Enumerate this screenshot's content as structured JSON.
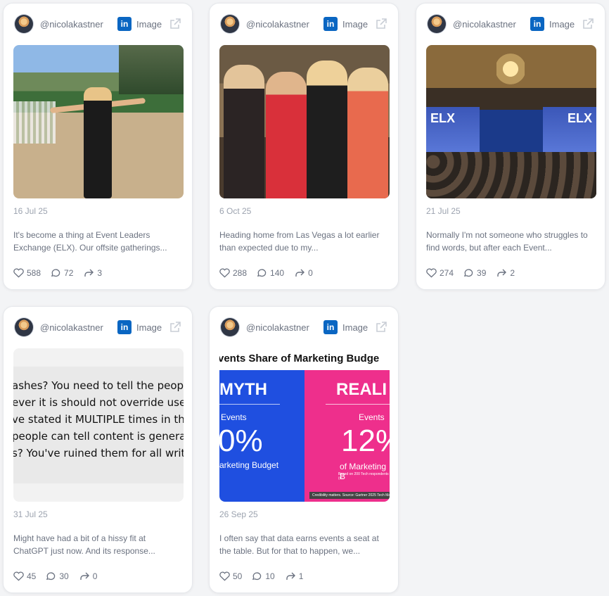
{
  "posts": [
    {
      "handle": "@nicolakastner",
      "platform": "in",
      "kind": "Image",
      "date": "16 Jul 25",
      "caption": "It's become a thing at Event Leaders Exchange (ELX). Our offsite gatherings...",
      "likes": "588",
      "comments": "72",
      "shares": "3"
    },
    {
      "handle": "@nicolakastner",
      "platform": "in",
      "kind": "Image",
      "date": "6 Oct 25",
      "caption": "Heading home from Las Vegas a lot earlier than expected due to my...",
      "likes": "288",
      "comments": "140",
      "shares": "0"
    },
    {
      "handle": "@nicolakastner",
      "platform": "in",
      "kind": "Image",
      "date": "21 Jul 25",
      "caption": "Normally I'm not someone who struggles to find words, but after each Event...",
      "likes": "274",
      "comments": "39",
      "shares": "2",
      "screen_text_left": "ELX",
      "screen_text_right": "ELX"
    },
    {
      "handle": "@nicolakastner",
      "platform": "in",
      "kind": "Image",
      "date": "31 Jul 25",
      "caption": "Might have had a bit of a hissy fit at ChatGPT just now. And its response...",
      "likes": "45",
      "comments": "30",
      "shares": "0",
      "image_lines": [
        "ashes?  You need to tell the people a",
        "ever it is should not override user in",
        "ve stated it MULTIPLE times in this c",
        "people can tell content is generated",
        "s?  You've ruined them for all writer"
      ]
    },
    {
      "handle": "@nicolakastner",
      "platform": "in",
      "kind": "Image",
      "date": "26 Sep 25",
      "caption": "I often say that data earns events a seat at the table. But for that to happen, we...",
      "likes": "50",
      "comments": "10",
      "shares": "1",
      "image_title": "vents Share of Marketing Budge",
      "myth_label": "MYTH",
      "myth_events": "Events",
      "myth_pct": "0%",
      "myth_sub": "arketing Budget",
      "reality_label": "REALI",
      "reality_events": "Events",
      "reality_pct": "12%",
      "reality_sub": "of Marketing B",
      "reality_note": "Based on 200 Tech  respondents (m",
      "footnote": "Credibility matters. Source: Gartner 2025 Tech Ma"
    }
  ]
}
